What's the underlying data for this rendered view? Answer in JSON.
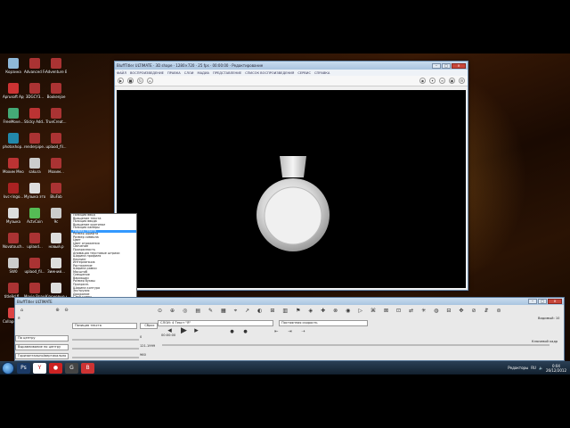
{
  "desktop": {
    "icons": [
      {
        "label": "Корзина",
        "color": "#8fb7d8"
      },
      {
        "label": "Aprusoft Apply R...",
        "color": "#c33"
      },
      {
        "label": "FreeMove...",
        "color": "#4a7"
      },
      {
        "label": "photoshop...",
        "color": "#28a"
      },
      {
        "label": "Мохим Мессидж",
        "color": "#b33"
      },
      {
        "label": "kvc-ringo...",
        "color": "#a22"
      },
      {
        "label": "Музыка",
        "color": "#ddd"
      },
      {
        "label": "Novatouch...",
        "color": "#a33"
      },
      {
        "label": "SW0",
        "color": "#ccc"
      },
      {
        "label": "title9d.fl...",
        "color": "#a33"
      },
      {
        "label": "Collapse 2009...",
        "color": "#d44"
      },
      {
        "label": "Advanced Forcify C...",
        "color": "#a33"
      },
      {
        "label": "3DGCY3...",
        "color": "#a33"
      },
      {
        "label": "Sticky Add...",
        "color": "#b33"
      },
      {
        "label": "renderpipe...",
        "color": "#a33"
      },
      {
        "label": "sakura",
        "color": "#ccc"
      },
      {
        "label": "Музыка этого",
        "color": "#ddd"
      },
      {
        "label": "ActvCoin",
        "color": "#5b5"
      },
      {
        "label": "uplaod...",
        "color": "#a33"
      },
      {
        "label": "uplaod_fil...",
        "color": "#a33"
      },
      {
        "label": "Movie Вращение",
        "color": "#a33"
      },
      {
        "label": "uplaod_fil...",
        "color": "#a33"
      },
      {
        "label": "Adventure Вы...",
        "color": "#a33"
      },
      {
        "label": "Bookenjoe",
        "color": "#a33"
      },
      {
        "label": "TrueCreat...",
        "color": "#a33"
      },
      {
        "label": "uplaod_fil...",
        "color": "#a33"
      },
      {
        "label": "Мохим...",
        "color": "#a33"
      },
      {
        "label": "BluFab",
        "color": "#a33"
      },
      {
        "label": "9c",
        "color": "#ccc"
      },
      {
        "label": "новый.p",
        "color": "#ddd"
      },
      {
        "label": "Зимний...",
        "color": "#ddd"
      },
      {
        "label": "Ключевые кадры",
        "color": "#ddd"
      }
    ]
  },
  "player": {
    "title": "BluffTitler ULTIMATE · 3D shape · 1280×720 · 25 fps · 00:00:00 · Редактирование",
    "menu": [
      "ФАЙЛ",
      "ВОСПРОИЗВЕДЕНИЕ",
      "ПРАВКА",
      "СЛОИ",
      "МАДИА",
      "ПРЕДСТАВЛЕНИЕ",
      "СПИСОК ВОСПРОИЗВЕДЕНИЯ",
      "СЕРВИС",
      "СПРАВКА"
    ]
  },
  "dropdown": {
    "options": [
      "Позиция ввод",
      "Вращение текста",
      "Позиция ввода",
      "Вращение оригинал",
      "Позиция камеры",
      "Размер текста",
      "Размер шрифта",
      "Размер символа",
      "Цвет",
      "Цвет отражения",
      "Свечение",
      "Прозрачность",
      "Анимация текстовые штрихи",
      "Ширина профиля",
      "Кернинг",
      "Интерлиньяж",
      "Растяжение",
      "Ширина рамки",
      "Масштаб",
      "Смещение",
      "Вариации",
      "Размер буквы",
      "Прозрачн.",
      "Ширина контура",
      "Экструзия",
      "Дрожание",
      "Слой сцены",
      "Размытие",
      "Отражение",
      "Группа",
      "Группа слоя",
      "Масштаб (группа)",
      "Количество",
      "Изображение шрифта",
      "Интерполяция",
      "Стиль",
      "Группы",
      "Вращение",
      "Прозрачность символов",
      "Позиция текста"
    ],
    "selected_index": 5
  },
  "editor": {
    "title": "BluffTitler ULTIMATE",
    "layer_select": "СЛОЙ: 4 Текст \"Я\"",
    "speed_select": "Постоянная скорость",
    "property_select": "Позиция текста",
    "apply_label": "Сброс",
    "frame_label": "Ключевой кадр",
    "time_code": "00:00:00",
    "time_label": "Видимый: 10",
    "rows": [
      {
        "label": "По центру"
      },
      {
        "label": "Выравнивание по центру"
      },
      {
        "label": "Горизонтально/вертикально"
      }
    ],
    "value_a": "0",
    "value_b": "121.1999",
    "value_c": "960",
    "value_text": "Я"
  },
  "taskbar": {
    "apps": [
      "Ps",
      "Y",
      "●",
      "G",
      "B"
    ],
    "lang": "RU",
    "notif_label": "Редакторы",
    "time": "0:04",
    "date": "26/12/2012"
  },
  "colors": {
    "accent": "#3399ff",
    "taskbar": "#12202e"
  }
}
